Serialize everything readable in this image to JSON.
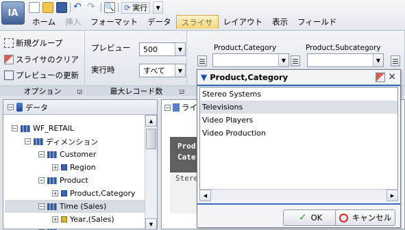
{
  "app": {
    "logo": "IA"
  },
  "qat": {
    "run_label": "実行"
  },
  "tabs": [
    "ホーム",
    "挿入",
    "フォーマット",
    "データ",
    "スライサ",
    "レイアウト",
    "表示",
    "フィールド"
  ],
  "ribbon": {
    "options": {
      "new_group": "新規グループ",
      "clear_slicer": "スライサのクリア",
      "update_preview": "プレビューの更新",
      "label": "オプション"
    },
    "records": {
      "preview_label": "プレビュー",
      "preview_value": "500",
      "run_label": "実行時",
      "run_value": "すべて",
      "label": "最大レコード数"
    },
    "slicers": [
      {
        "title": "Product,Category"
      },
      {
        "title": "Product,Subcategory"
      }
    ]
  },
  "data_panel": {
    "title": "データ",
    "tree": [
      {
        "label": "WF_RETAIL"
      },
      {
        "label": "ディメンション"
      },
      {
        "label": "Customer"
      },
      {
        "label": "Region"
      },
      {
        "label": "Product"
      },
      {
        "label": "Product,Category"
      },
      {
        "label": "Time (Sales)"
      },
      {
        "label": "Year,(Sales)"
      }
    ]
  },
  "main": {
    "tab_label": "ライフ",
    "heading_line1": "Prod",
    "heading_line2": "Cate",
    "row1": "Stere"
  },
  "popup": {
    "title": "Product,Category",
    "items": [
      "Stereo Systems",
      "Televisions",
      "Video Players",
      "Video Production"
    ],
    "ok": "OK",
    "cancel": "キャンセル"
  }
}
